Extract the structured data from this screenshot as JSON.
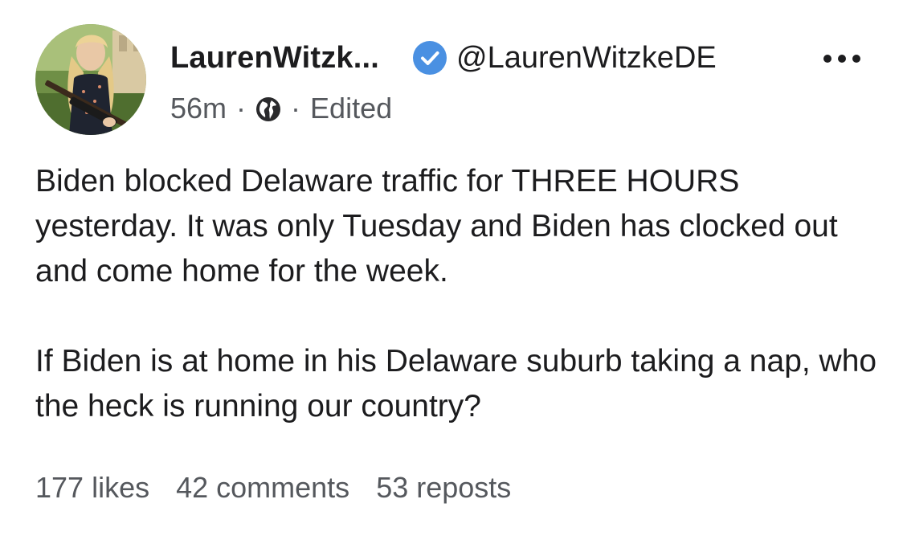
{
  "author": {
    "display_name": "LaurenWitzk...",
    "handle": "@LaurenWitzkeDE",
    "verified": true,
    "avatar_icon": "profile-photo",
    "badge_color": "#4a90e2"
  },
  "meta": {
    "time": "56m",
    "separator": "·",
    "visibility_icon": "globe-icon",
    "edited_label": "Edited"
  },
  "more_icon": "more-dots-icon",
  "body": {
    "paragraphs": [
      "Biden blocked Delaware traffic for THREE HOURS yesterday. It was only Tuesday and Biden has clocked out and come home for the week.",
      "If Biden is at home in his Delaware suburb taking a nap, who the heck is running our country?"
    ]
  },
  "stats": {
    "likes": "177 likes",
    "comments": "42 comments",
    "reposts": "53 reposts"
  }
}
